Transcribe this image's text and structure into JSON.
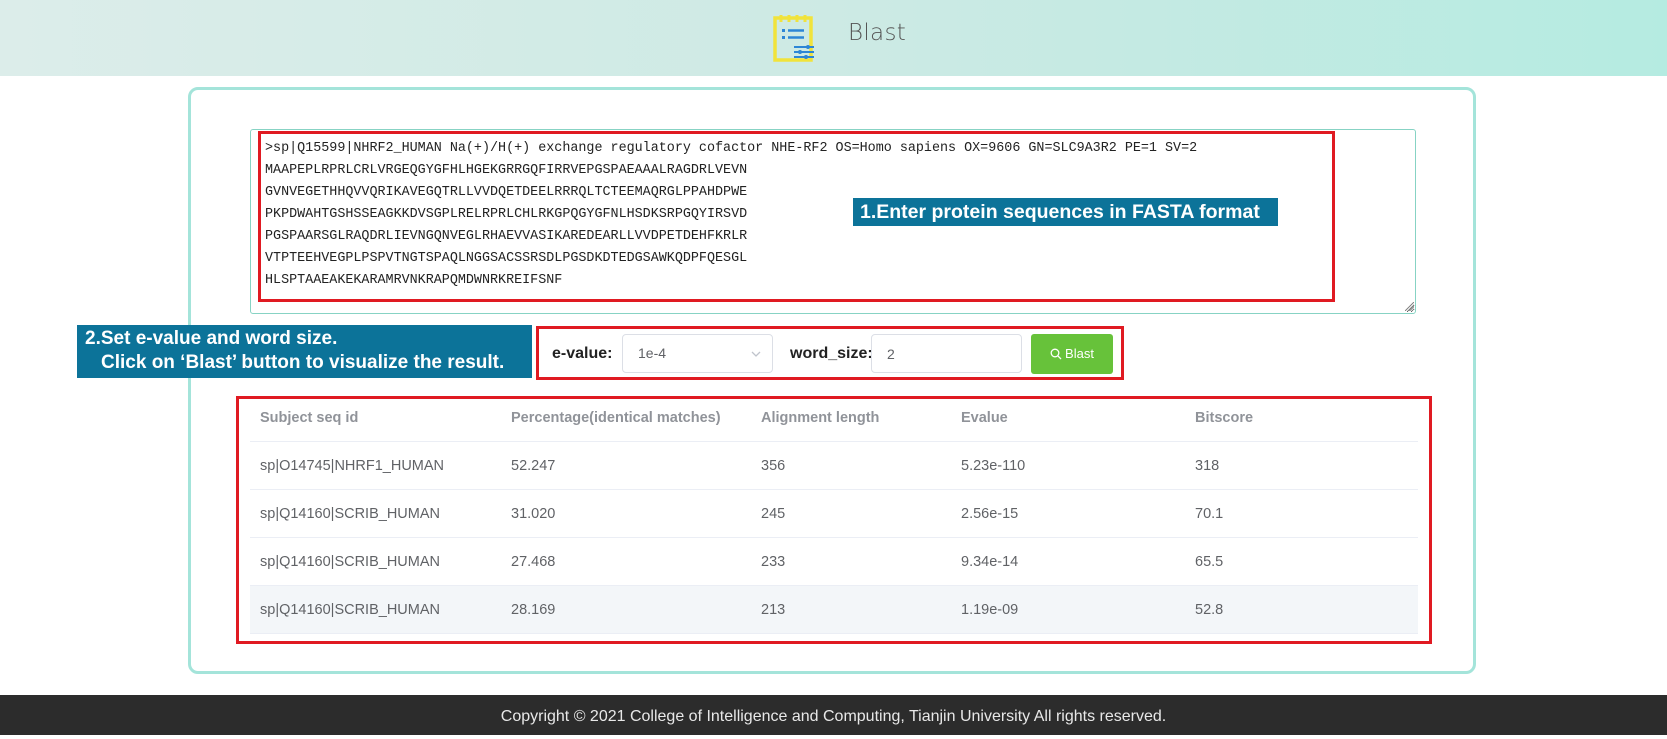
{
  "header": {
    "title": "Blast",
    "logo_icon": "document-settings-icon"
  },
  "sequence_input": {
    "value": ">sp|Q15599|NHRF2_HUMAN Na(+)/H(+) exchange regulatory cofactor NHE-RF2 OS=Homo sapiens OX=9606 GN=SLC9A3R2 PE=1 SV=2\nMAAPEPLRPRLCRLVRGEQGYGFHLHGEKGRRGQFIRRVEPGSPAEAAALRAGDRLVEVN\nGVNVEGETHHQVVQRIKAVEGQTRLLVVDQETDEELRRRQLTCTEEMAQRGLPPAHDPWE\nPKPDWAHTGSHSSEAGKKDVSGPLRELRPRLCHLRKGPQGYGFNLHSDKSRPGQYIRSVD\nPGSPAARSGLRAQDRLIEVNGQNVEGLRHAEVVASIKAREDEARLLVVDPETDEHFKRLR\nVTPTEEHVEGPLPSPVTNGTSPAQLNGGSACSSRSDLPGSDKDTEDGSAWKQDPFQESGL\nHLSPTAAEAKEKARAMRVNKRAPQMDWNRKREIFSNF"
  },
  "annotations": {
    "step1": "1.Enter protein sequences in FASTA format",
    "step2_line1": "2.Set e-value and word size.",
    "step2_line2": "Click on ‘Blast’ button to visualize the result."
  },
  "controls": {
    "evalue_label": "e-value:",
    "evalue_selected": "1e-4",
    "word_size_label": "word_size:",
    "word_size_value": "2",
    "blast_button": "Blast",
    "blast_icon": "search-icon"
  },
  "results": {
    "columns": [
      "Subject seq id",
      "Percentage(identical matches)",
      "Alignment length",
      "Evalue",
      "Bitscore"
    ],
    "rows": [
      [
        "sp|O14745|NHRF1_HUMAN",
        "52.247",
        "356",
        "5.23e-110",
        "318"
      ],
      [
        "sp|Q14160|SCRIB_HUMAN",
        "31.020",
        "245",
        "2.56e-15",
        "70.1"
      ],
      [
        "sp|Q14160|SCRIB_HUMAN",
        "27.468",
        "233",
        "9.34e-14",
        "65.5"
      ],
      [
        "sp|Q14160|SCRIB_HUMAN",
        "28.169",
        "213",
        "1.19e-09",
        "52.8"
      ]
    ]
  },
  "footer": {
    "text": "Copyright © 2021 College of Intelligence and Computing, Tianjin University All rights reserved."
  },
  "colors": {
    "header_gradient_end": "#b5ebe1",
    "panel_border": "#a4e4da",
    "callout": "#0c7399",
    "highlight_box": "#e01a22",
    "blast_button": "#67c23a",
    "footer": "#2c2c2c"
  }
}
